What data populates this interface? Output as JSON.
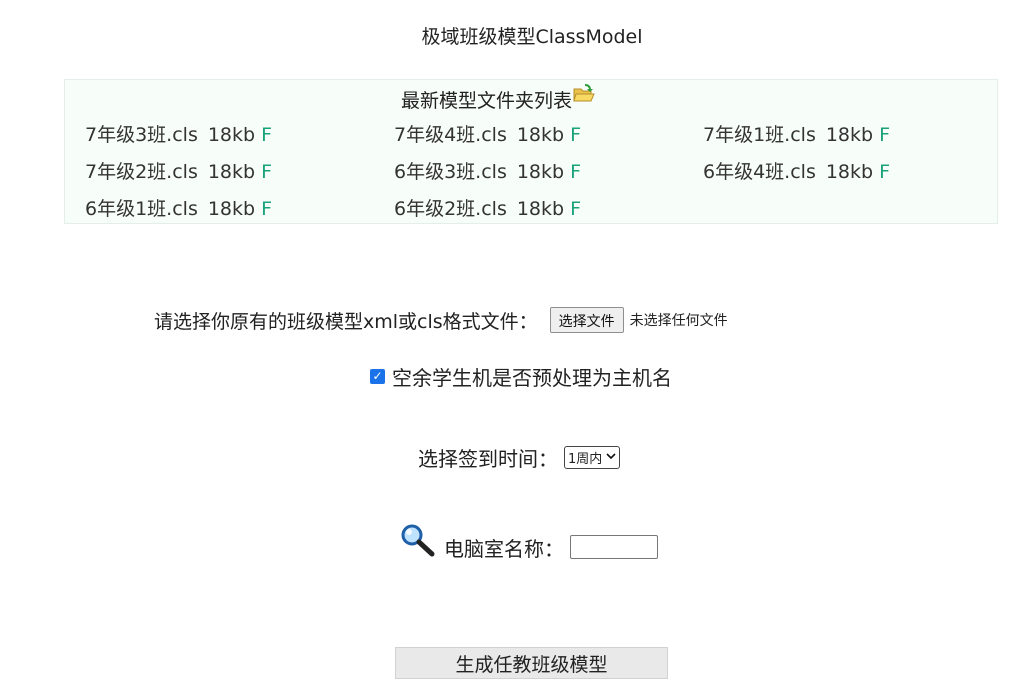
{
  "page": {
    "title": "极域班级模型ClassModel"
  },
  "panel": {
    "title": "最新模型文件夹列表",
    "files": [
      {
        "name": "7年级3班.cls",
        "size": "18kb",
        "flag": "F"
      },
      {
        "name": "7年级4班.cls",
        "size": "18kb",
        "flag": "F"
      },
      {
        "name": "7年级1班.cls",
        "size": "18kb",
        "flag": "F"
      },
      {
        "name": "7年级2班.cls",
        "size": "18kb",
        "flag": "F"
      },
      {
        "name": "6年级3班.cls",
        "size": "18kb",
        "flag": "F"
      },
      {
        "name": "6年级4班.cls",
        "size": "18kb",
        "flag": "F"
      },
      {
        "name": "6年级1班.cls",
        "size": "18kb",
        "flag": "F"
      },
      {
        "name": "6年级2班.cls",
        "size": "18kb",
        "flag": "F"
      }
    ]
  },
  "upload": {
    "label": "请选择你原有的班级模型xml或cls格式文件：",
    "button_label": "选择文件",
    "status": "未选择任何文件"
  },
  "preprocess": {
    "checked": true,
    "label": "空余学生机是否预处理为主机名"
  },
  "signin": {
    "label": "选择签到时间：",
    "selected": "1周内"
  },
  "lab": {
    "label": "电脑室名称：",
    "value": ""
  },
  "generate_button": "生成任教班级模型",
  "icons": {
    "folder": "folder-open-icon",
    "search": "magnifier-icon"
  },
  "colors": {
    "flag": "#1aa37a",
    "panel_bg": "#f7fdf9",
    "checkbox": "#1a73e8"
  }
}
